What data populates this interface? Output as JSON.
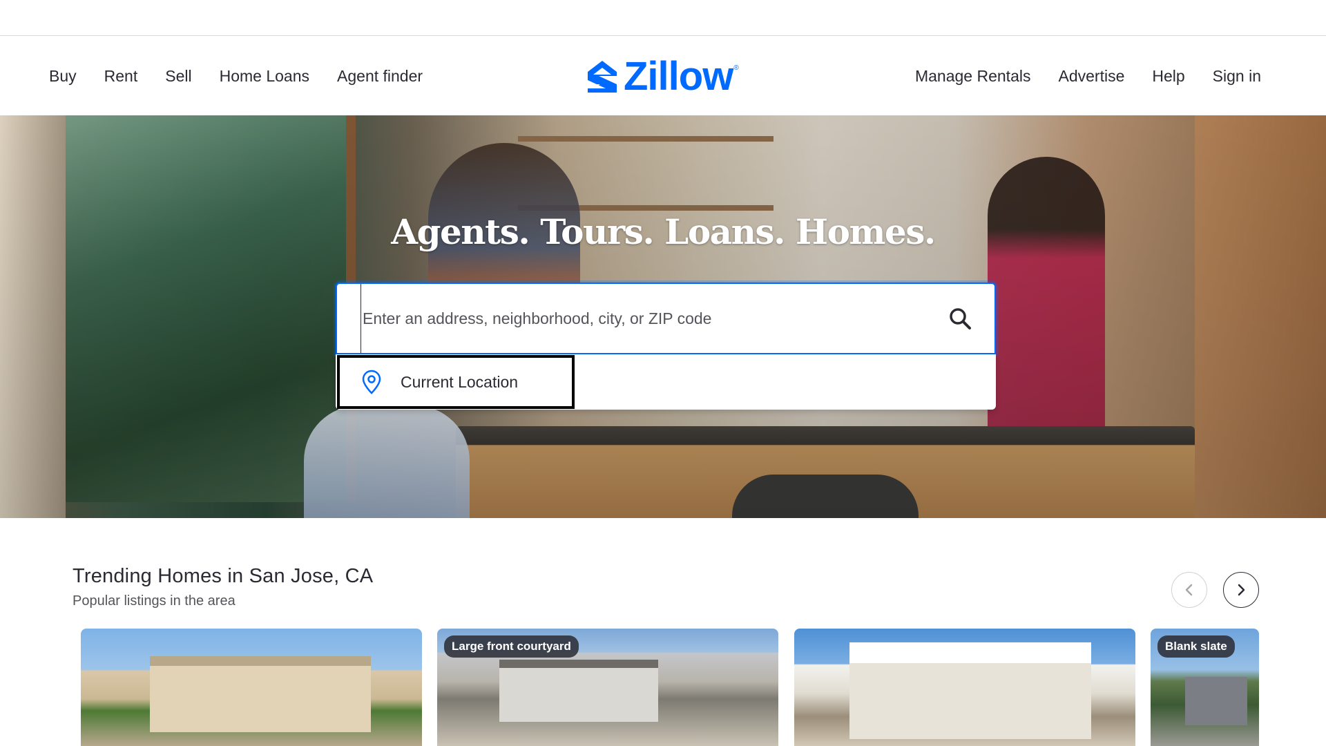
{
  "header": {
    "nav_left": [
      "Buy",
      "Rent",
      "Sell",
      "Home Loans",
      "Agent finder"
    ],
    "nav_right": [
      "Manage Rentals",
      "Advertise",
      "Help",
      "Sign in"
    ],
    "logo_text": "Zillow",
    "logo_registered": "®"
  },
  "hero": {
    "title": "Agents. Tours. Loans. Homes.",
    "search_placeholder": "Enter an address, neighborhood, city, or ZIP code",
    "search_value": "",
    "dropdown_item": "Current Location"
  },
  "trending": {
    "title": "Trending Homes in San Jose, CA",
    "subtitle": "Popular listings in the area",
    "cards": [
      {
        "tag": ""
      },
      {
        "tag": "Large front courtyard"
      },
      {
        "tag": ""
      },
      {
        "tag": "Blank slate"
      }
    ]
  },
  "colors": {
    "brand": "#006aff",
    "text": "#2a2a33"
  },
  "icons": {
    "logo": "zillow-logo-icon",
    "search": "search-icon",
    "location": "location-pin-icon",
    "prev": "chevron-left-icon",
    "next": "chevron-right-icon"
  }
}
